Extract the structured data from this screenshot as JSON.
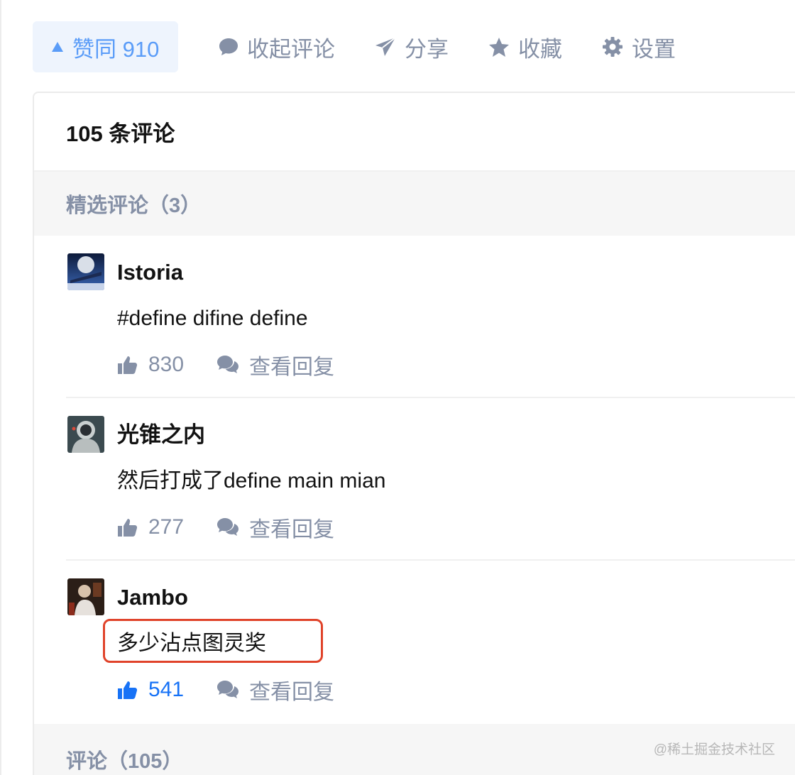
{
  "actions": {
    "vote_label": "赞同 910",
    "collapse_label": "收起评论",
    "share_label": "分享",
    "favorite_label": "收藏",
    "settings_label": "设置"
  },
  "card": {
    "title": "105 条评论",
    "featured_label": "精选评论（3）",
    "all_label": "评论（105）"
  },
  "comments": [
    {
      "author": "Istoria",
      "content": "#define difine define",
      "likes": "830",
      "reply_label": "查看回复",
      "liked": false,
      "avatar": "moon-night-avatar"
    },
    {
      "author": "光锥之内",
      "content": "然后打成了define main mian",
      "likes": "277",
      "reply_label": "查看回复",
      "liked": false,
      "avatar": "astronaut-avatar"
    },
    {
      "author": "Jambo",
      "content": "多少沾点图灵奖",
      "likes": "541",
      "reply_label": "查看回复",
      "liked": true,
      "highlighted": true,
      "avatar": "portrait-avatar"
    }
  ],
  "watermark": "@稀土掘金技术社区",
  "colors": {
    "accent": "#1772f6",
    "vote_bg": "#eef4fd",
    "muted": "#8590a6",
    "highlight_border": "#e0432a"
  }
}
